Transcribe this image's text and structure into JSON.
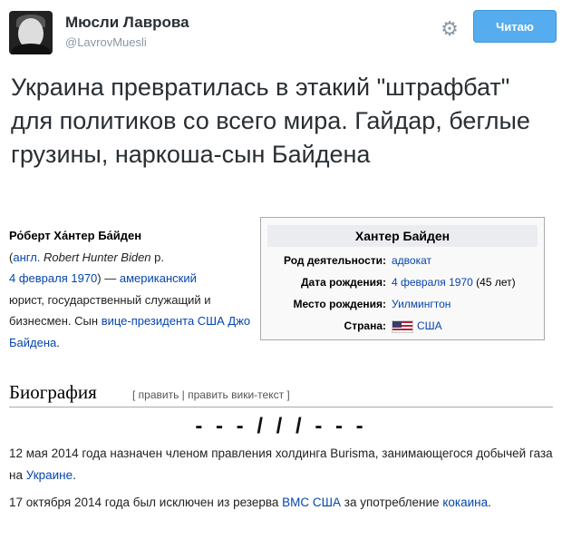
{
  "account": {
    "name": "Мюсли Лаврова",
    "handle": "@LavrovMuesli",
    "follow_label": "Читаю"
  },
  "tweet": {
    "text": "Украина превратилась в этакий \"штрафбат\" для политиков со всего мира. Гайдар, беглые грузины, наркоша-сын Байдена"
  },
  "wiki": {
    "lead": {
      "name": "Ро́берт Ха́нтер Ба́йден",
      "lang_prefix": "англ.",
      "orig_name": "Robert Hunter Biden",
      "born_prefix": "р.",
      "date_link": "4 февраля 1970",
      "dash": " — ",
      "nationality_link": "американский",
      "occupation": "юрист, государственный служащий и бизнесмен. Сын",
      "vp_link": "вице-президента США",
      "father_link": "Джо Байдена"
    },
    "infobox": {
      "title": "Хантер Байден",
      "rows": [
        {
          "label": "Род деятельности:",
          "value": "адвокат"
        },
        {
          "label": "Дата рождения:",
          "value": "4 февраля 1970",
          "suffix": "(45 лет)"
        },
        {
          "label": "Место рождения:",
          "value": "Уилмингтон"
        },
        {
          "label": "Страна:",
          "value": "США"
        }
      ]
    },
    "bio": {
      "heading": "Биография",
      "edit": "[ править | править вики-текст ]",
      "separator": "- - - / / / - - -",
      "p1_text": "12 мая 2014 года назначен членом правления холдинга Burisma, занимающегося добычей газа на ",
      "p1_link": "Украине",
      "p1_end": ".",
      "p2_text": "17 октября 2014 года был исключен из резерва ",
      "p2_link1": "ВМС США",
      "p2_mid": " за употребление ",
      "p2_link2": "кокаина",
      "p2_end": "."
    }
  }
}
